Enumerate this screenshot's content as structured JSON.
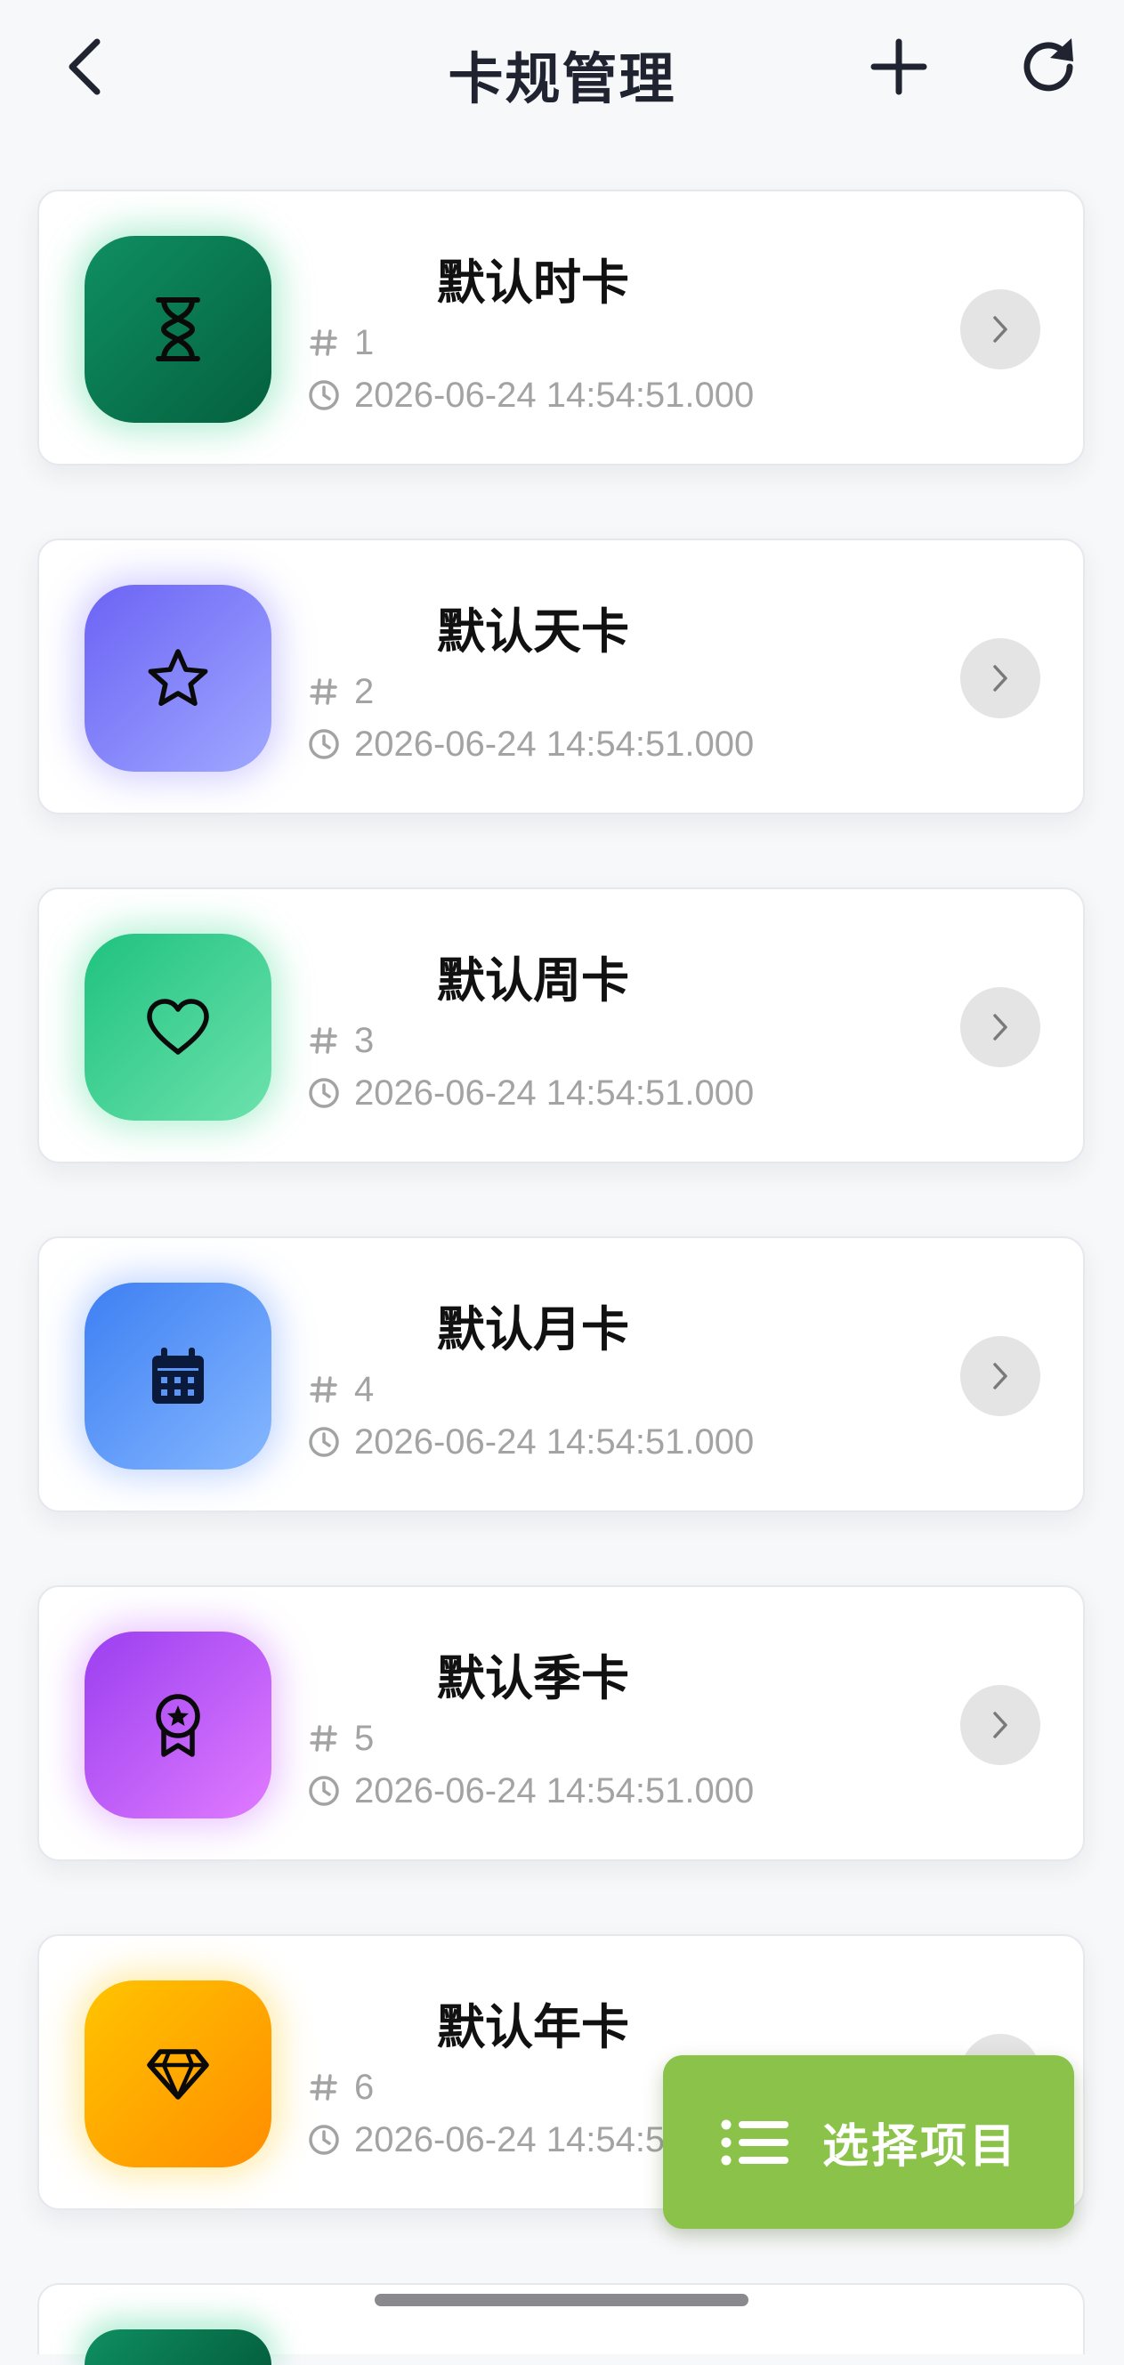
{
  "header": {
    "title": "卡规管理",
    "back_icon": "chevron-left-icon",
    "add_icon": "plus-icon",
    "refresh_icon": "refresh-icon"
  },
  "cards": [
    {
      "name": "默认时卡",
      "id": "1",
      "time": "2026-06-24 14:54:51.000",
      "icon": "hourglass-icon",
      "color_from": "#0f8f62",
      "color_to": "#04603e",
      "glow": "#39d28f"
    },
    {
      "name": "默认天卡",
      "id": "2",
      "time": "2026-06-24 14:54:51.000",
      "icon": "star-icon",
      "color_from": "#6c63f5",
      "color_to": "#9fa8ff",
      "glow": "#8f86ff"
    },
    {
      "name": "默认周卡",
      "id": "3",
      "time": "2026-06-24 14:54:51.000",
      "icon": "heart-icon",
      "color_from": "#1fc27f",
      "color_to": "#6de2ad",
      "glow": "#49dc99"
    },
    {
      "name": "默认月卡",
      "id": "4",
      "time": "2026-06-24 14:54:51.000",
      "icon": "calendar-icon",
      "color_from": "#3d7ff3",
      "color_to": "#86b8ff",
      "glow": "#6c9cff"
    },
    {
      "name": "默认季卡",
      "id": "5",
      "time": "2026-06-24 14:54:51.000",
      "icon": "award-icon",
      "color_from": "#9b3ff0",
      "color_to": "#e07bff",
      "glow": "#c76bff"
    },
    {
      "name": "默认年卡",
      "id": "6",
      "time": "2026-06-24 14:54:51.000",
      "icon": "diamond-icon",
      "color_from": "#ffc400",
      "color_to": "#ff8d00",
      "glow": "#ffd23a"
    },
    {
      "name": "",
      "id": "",
      "time": "",
      "icon": "",
      "color_from": "#0f8f62",
      "color_to": "#04603e",
      "glow": "#39d28f"
    }
  ],
  "fab": {
    "label": "选择项目",
    "icon": "list-icon"
  },
  "colors": {
    "fab": "#8bc34a",
    "meta_text": "#a3a3a3"
  }
}
